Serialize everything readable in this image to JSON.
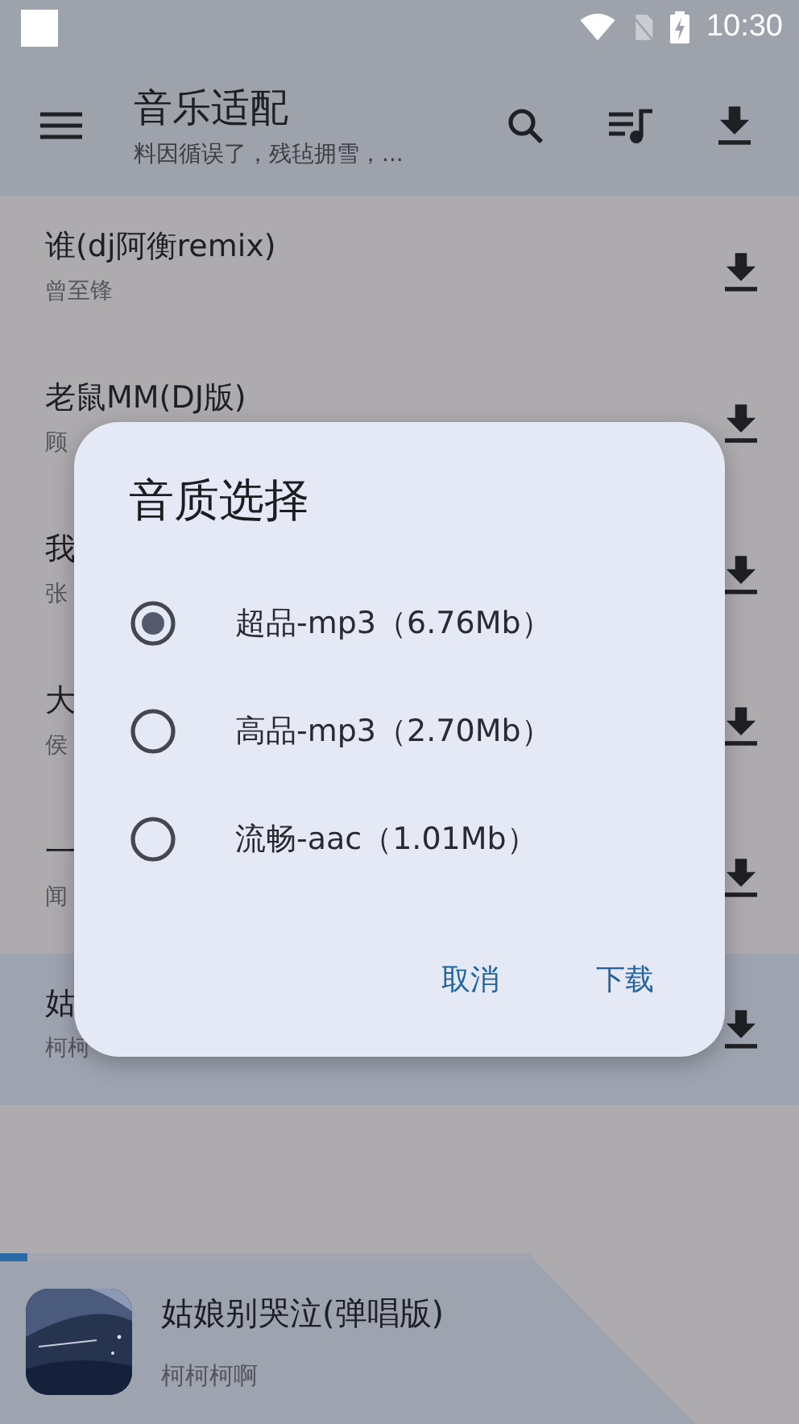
{
  "status_bar": {
    "time": "10:30"
  },
  "toolbar": {
    "title": "音乐适配",
    "subtitle": "料因循误了，残毡拥雪，..."
  },
  "songs": [
    {
      "title": "谁(dj阿衡remix)",
      "artist": "曾至锋",
      "selected": false
    },
    {
      "title": "老鼠MM(DJ版)",
      "artist": "顾",
      "selected": false
    },
    {
      "title": "我",
      "artist": "张",
      "selected": false
    },
    {
      "title": "大",
      "artist": "侯",
      "selected": false
    },
    {
      "title": "一",
      "artist": "闻",
      "selected": false
    },
    {
      "title": "姑",
      "artist": "柯柯",
      "selected": true
    }
  ],
  "dialog": {
    "title": "音质选择",
    "options": [
      {
        "label": "超品-mp3（6.76Mb）",
        "selected": true
      },
      {
        "label": "高品-mp3（2.70Mb）",
        "selected": false
      },
      {
        "label": "流畅-aac（1.01Mb）",
        "selected": false
      }
    ],
    "buttons": [
      "取消",
      "下载"
    ]
  },
  "player": {
    "title": "姑娘别哭泣(弹唱版)",
    "artist": "柯柯柯啊",
    "level": 0.05
  }
}
